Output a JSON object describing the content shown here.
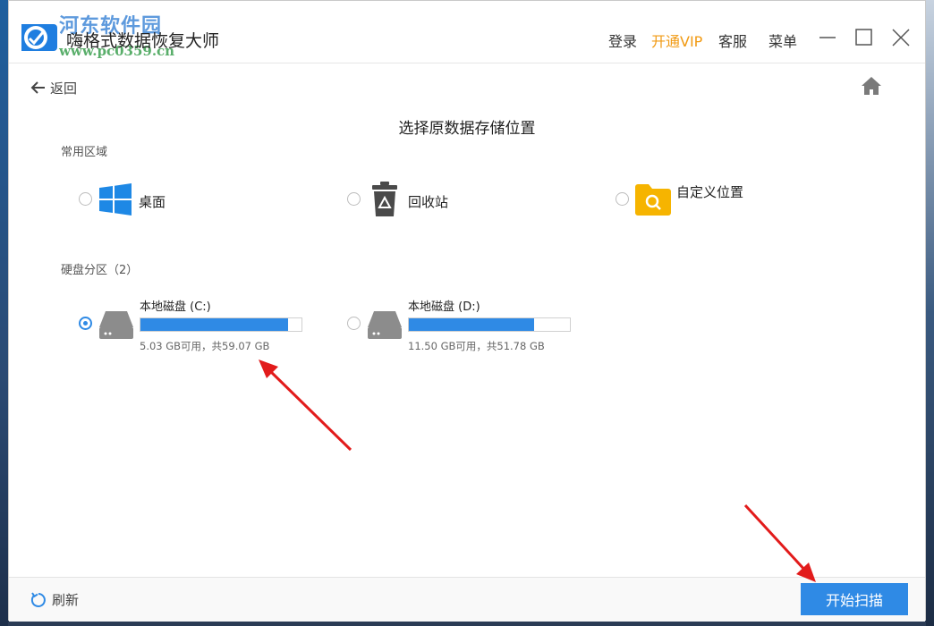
{
  "app": {
    "title": "嗨格式数据恢复大师"
  },
  "watermark": {
    "text": "河东软件园",
    "url": "www.pc0359.cn"
  },
  "titlebar": {
    "login": "登录",
    "vip": "开通VIP",
    "service": "客服",
    "menu": "菜单"
  },
  "nav": {
    "back": "返回"
  },
  "page": {
    "title": "选择原数据存储位置"
  },
  "common": {
    "label": "常用区域",
    "items": [
      {
        "label": "桌面",
        "icon": "windows-icon"
      },
      {
        "label": "回收站",
        "icon": "recycle-bin-icon"
      },
      {
        "label": "自定义位置",
        "icon": "folder-search-icon"
      }
    ]
  },
  "disks": {
    "label": "硬盘分区（2）",
    "items": [
      {
        "name": "本地磁盘 (C:)",
        "capacity": "5.03 GB可用，共59.07 GB",
        "used_fraction": 0.915,
        "selected": true
      },
      {
        "name": "本地磁盘 (D:)",
        "capacity": "11.50 GB可用，共51.78 GB",
        "used_fraction": 0.778,
        "selected": false
      }
    ]
  },
  "footer": {
    "refresh": "刷新",
    "scan": "开始扫描"
  },
  "colors": {
    "accent": "#2f8ae5",
    "vip": "#f19a13",
    "folder": "#f6b400"
  }
}
